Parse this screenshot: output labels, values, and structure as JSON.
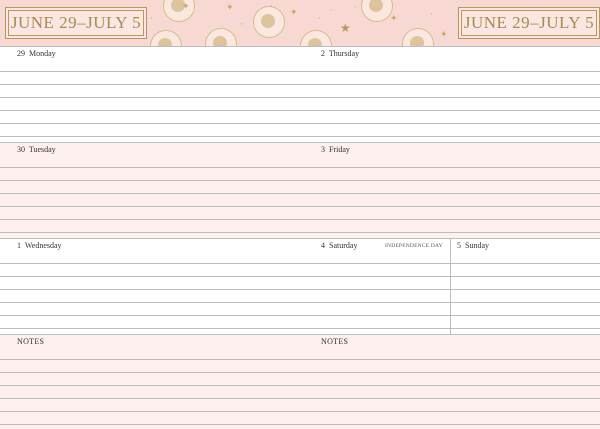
{
  "header": {
    "title_left": "JUNE 29–JULY 5",
    "title_right": "JUNE 29–JULY 5"
  },
  "days": [
    {
      "number": "29",
      "name": "Monday"
    },
    {
      "number": "2",
      "name": "Thursday"
    },
    {
      "number": "30",
      "name": "Tuesday"
    },
    {
      "number": "3",
      "name": "Friday"
    },
    {
      "number": "1",
      "name": "Wednesday"
    },
    {
      "number": "4",
      "name": "Saturday"
    },
    {
      "number": "5",
      "name": "Sunday"
    }
  ],
  "holiday": "INDEPENDENCE DAY",
  "notes": [
    "NOTES",
    "NOTES"
  ],
  "colors": {
    "band": "#f7d8d2",
    "gold": "#b8975a",
    "pink_section": "#fdf0ee",
    "rule": "#bdbdbd"
  }
}
